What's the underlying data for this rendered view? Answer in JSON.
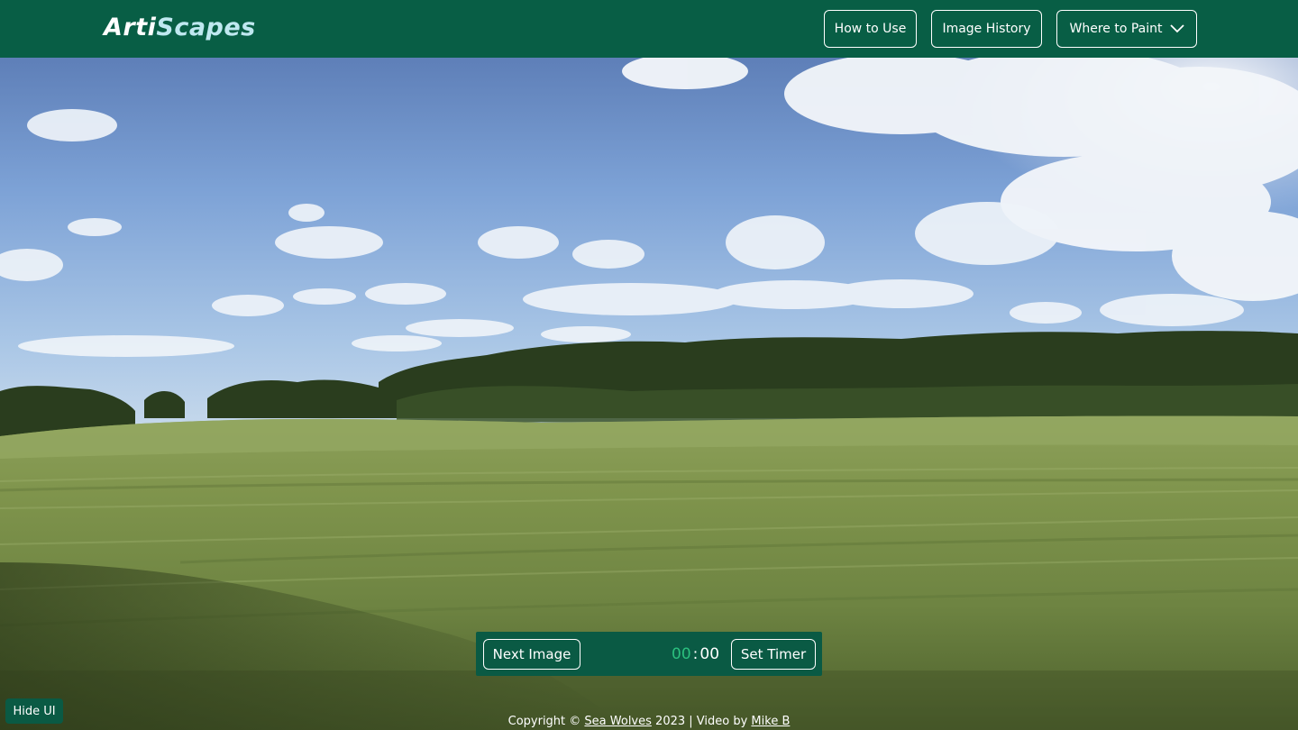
{
  "header": {
    "brand_part1": "Arti",
    "brand_part2": "Scapes",
    "nav": {
      "how_to_use": "How to Use",
      "image_history": "Image History",
      "where_to_paint": "Where to Paint"
    }
  },
  "icons": {
    "where_to_paint": "chevron-down-icon"
  },
  "controls": {
    "next_image": "Next Image",
    "timer_minutes": "00",
    "timer_separator": ":",
    "timer_seconds": "00",
    "set_timer": "Set Timer",
    "hide_ui": "Hide UI"
  },
  "footer": {
    "copyright_prefix": "Copyright ©",
    "org_link": "Sea Wolves",
    "year_and_credit": "2023 | Video by",
    "author_link": "Mike B"
  },
  "colors": {
    "brand_green": "#085e45",
    "timer_minutes_green": "#2bbf7e",
    "brand_accent": "#bfe8f0"
  }
}
